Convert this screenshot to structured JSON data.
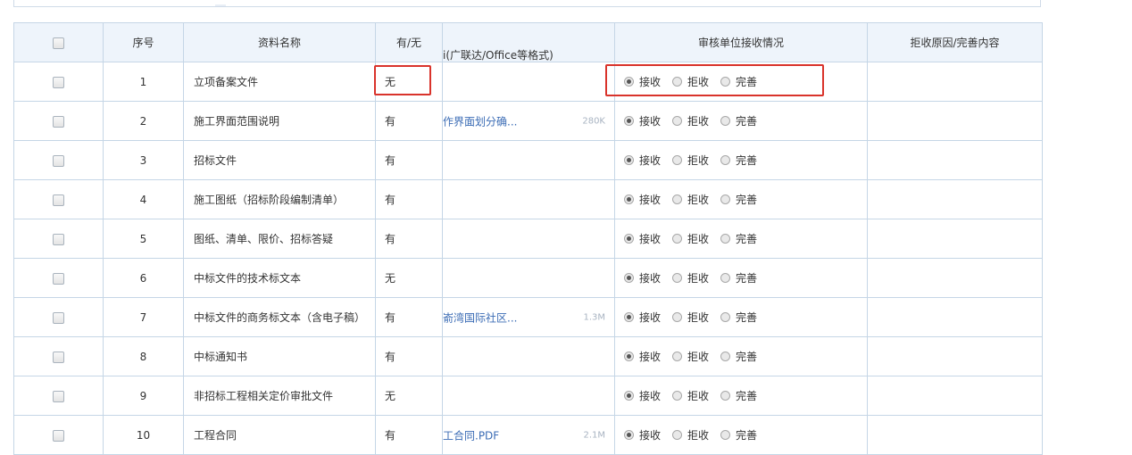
{
  "columns": {
    "select": "",
    "seq": "序号",
    "name": "资料名称",
    "has": "有/无",
    "file": "i(广联达/Office等格式)",
    "review": "审核单位接收情况",
    "reason": "拒收原因/完善内容"
  },
  "radio_labels": [
    "接收",
    "拒收",
    "完善"
  ],
  "rows": [
    {
      "seq": "1",
      "name": "立项备案文件",
      "has": "无",
      "file": "",
      "size": "",
      "selected": "接收",
      "reason": ""
    },
    {
      "seq": "2",
      "name": "施工界面范围说明",
      "has": "有",
      "file": "作界面划分确...",
      "size": "280K",
      "selected": "接收",
      "reason": ""
    },
    {
      "seq": "3",
      "name": "招标文件",
      "has": "有",
      "file": "",
      "size": "",
      "selected": "接收",
      "reason": ""
    },
    {
      "seq": "4",
      "name": "施工图纸（招标阶段编制清单）",
      "has": "有",
      "file": "",
      "size": "",
      "selected": "接收",
      "reason": ""
    },
    {
      "seq": "5",
      "name": "图纸、清单、限价、招标答疑",
      "has": "有",
      "file": "",
      "size": "",
      "selected": "接收",
      "reason": ""
    },
    {
      "seq": "6",
      "name": "中标文件的技术标文本",
      "has": "无",
      "file": "",
      "size": "",
      "selected": "接收",
      "reason": ""
    },
    {
      "seq": "7",
      "name": "中标文件的商务标文本（含电子稿）",
      "has": "有",
      "file": "嵛湾国际社区...",
      "size": "1.3M",
      "selected": "接收",
      "reason": ""
    },
    {
      "seq": "8",
      "name": "中标通知书",
      "has": "有",
      "file": "",
      "size": "",
      "selected": "接收",
      "reason": ""
    },
    {
      "seq": "9",
      "name": "非招标工程相关定价审批文件",
      "has": "无",
      "file": "",
      "size": "",
      "selected": "接收",
      "reason": ""
    },
    {
      "seq": "10",
      "name": "工程合同",
      "has": "有",
      "file": "工合同.PDF",
      "size": "2.1M",
      "selected": "接收",
      "reason": ""
    }
  ],
  "colors": {
    "header_bg": "#eef4fb",
    "border": "#c5d6e6",
    "highlight": "#d9332b",
    "file_link": "#3b6cb5"
  }
}
